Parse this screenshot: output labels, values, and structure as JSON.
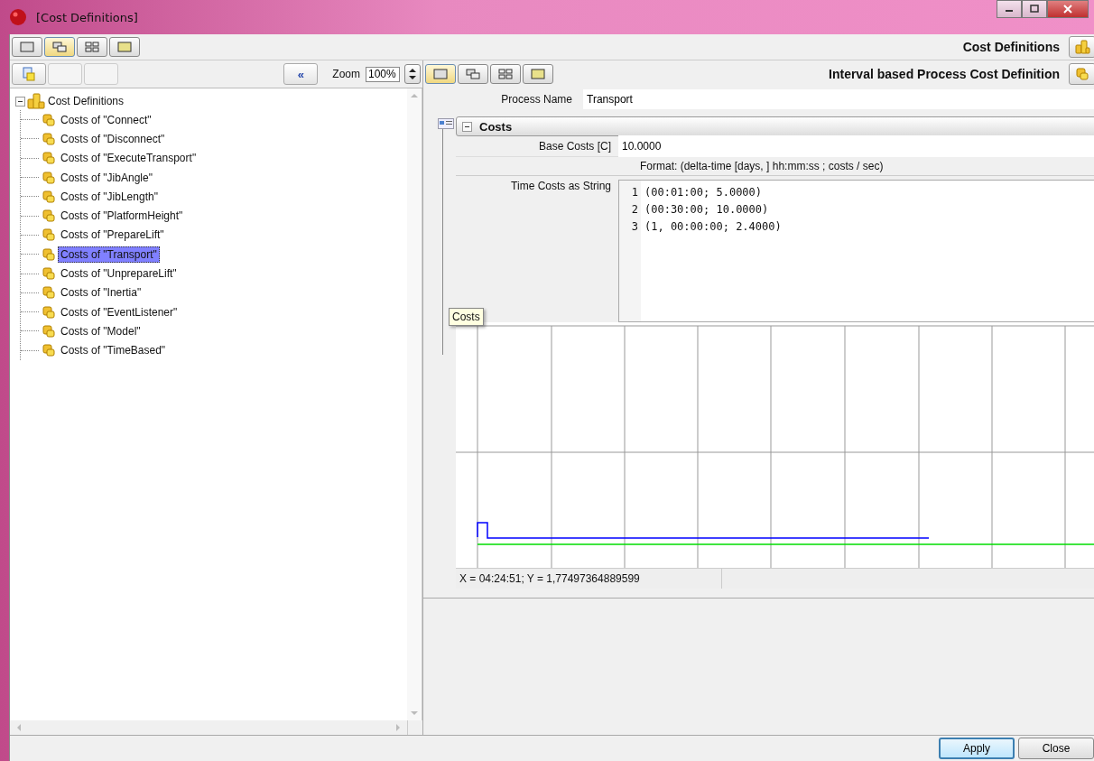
{
  "window": {
    "title": "[Cost Definitions]"
  },
  "view_buttons": [
    {
      "kind": "single",
      "selected": false
    },
    {
      "kind": "cascade",
      "selected": true
    },
    {
      "kind": "tile",
      "selected": false
    },
    {
      "kind": "highlight",
      "selected": false
    }
  ],
  "header": {
    "title": "Cost Definitions"
  },
  "tree_toolbar": {
    "collapse_button": "«",
    "zoom_label": "Zoom",
    "zoom_value": "100%"
  },
  "tree": {
    "label": "Cost Definitions",
    "expanded": true,
    "children": [
      {
        "label": "Costs of \"Connect\"",
        "selected": false
      },
      {
        "label": "Costs of \"Disconnect\"",
        "selected": false
      },
      {
        "label": "Costs of \"ExecuteTransport\"",
        "selected": false
      },
      {
        "label": "Costs of \"JibAngle\"",
        "selected": false
      },
      {
        "label": "Costs of \"JibLength\"",
        "selected": false
      },
      {
        "label": "Costs of \"PlatformHeight\"",
        "selected": false
      },
      {
        "label": "Costs of \"PrepareLift\"",
        "selected": false
      },
      {
        "label": "Costs of \"Transport\"",
        "selected": true
      },
      {
        "label": "Costs of \"UnprepareLift\"",
        "selected": false
      },
      {
        "label": "Costs of \"Inertia\"",
        "selected": false
      },
      {
        "label": "Costs of \"EventListener\"",
        "selected": false
      },
      {
        "label": "Costs of \"Model\"",
        "selected": false
      },
      {
        "label": "Costs of \"TimeBased\"",
        "selected": false
      }
    ]
  },
  "editor": {
    "view_buttons": [
      {
        "kind": "single",
        "selected": true
      },
      {
        "kind": "cascade",
        "selected": false
      },
      {
        "kind": "tile",
        "selected": false
      },
      {
        "kind": "highlight",
        "selected": false
      }
    ],
    "title": "Interval based Process Cost Definition",
    "process_name": {
      "label": "Process Name",
      "value": "Transport"
    },
    "group": {
      "title": "Costs",
      "expanded": true,
      "base_costs": {
        "label": "Base Costs [C]",
        "value": "10.0000"
      },
      "format_hint": "Format: (delta-time [days, ] hh:mm:ss ; costs / sec)",
      "time_costs": {
        "label": "Time Costs as String",
        "lines": [
          {
            "number": "1",
            "text": "(00:01:00; 5.0000)"
          },
          {
            "number": "2",
            "text": "(00:30:00; 10.0000)"
          },
          {
            "number": "3",
            "text": "(1, 00:00:00; 2.4000)"
          }
        ]
      },
      "tooltip": "Costs",
      "status": "X = 04:24:51; Y = 1,77497364889599"
    }
  },
  "buttons": [
    {
      "label": "Apply",
      "focused": true
    },
    {
      "label": "Close",
      "focused": false
    }
  ]
}
